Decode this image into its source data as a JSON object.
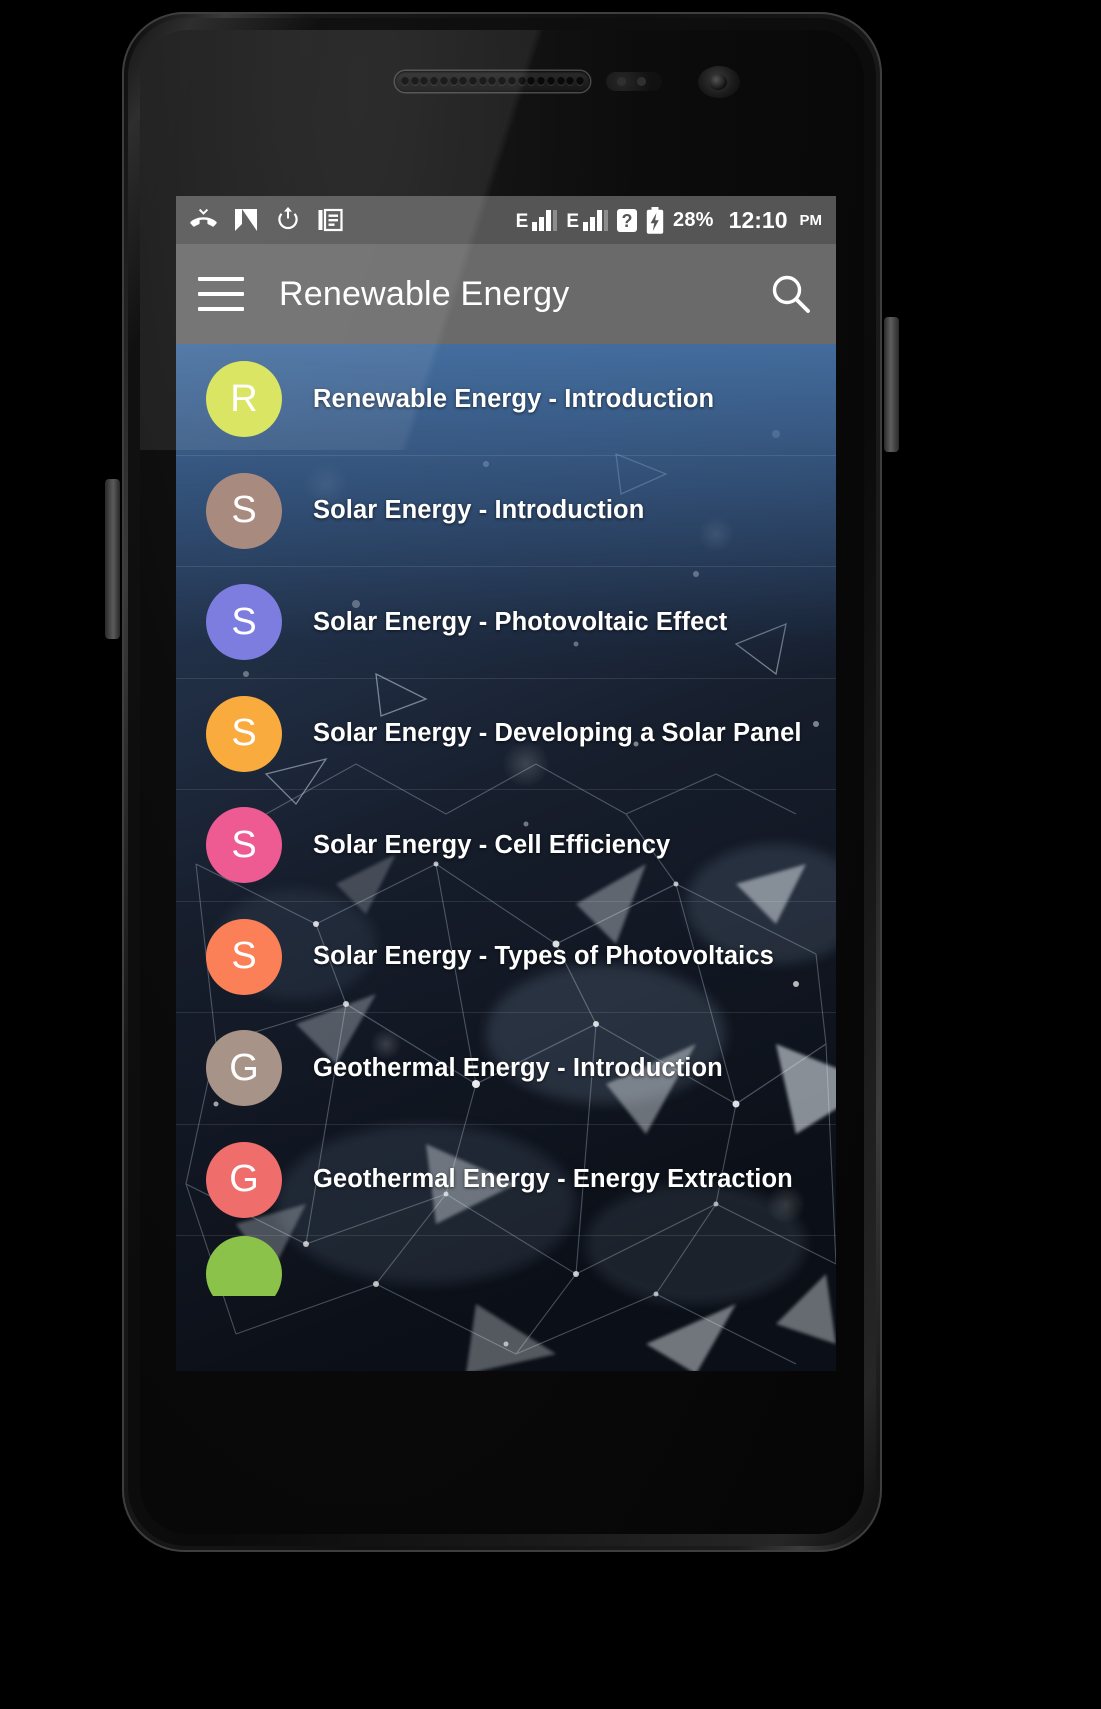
{
  "device": {
    "name": "android-phone"
  },
  "status_bar": {
    "left_icons": [
      "missed-call-icon",
      "nova-n-icon",
      "power-restart-icon",
      "document-list-icon"
    ],
    "sim1": {
      "network_label": "E",
      "signal_bars": 3
    },
    "sim2": {
      "network_label": "E",
      "signal_bars": 3
    },
    "question_icon": "question-mark-icon",
    "battery_icon": "battery-charging-icon",
    "battery_percent": "28%",
    "time": "12:10",
    "ampm": "PM"
  },
  "toolbar": {
    "menu_icon": "hamburger-menu-icon",
    "title": "Renewable Energy",
    "search_icon": "search-icon"
  },
  "colors": {
    "status_bar_bg": "#555555",
    "toolbar_bg": "#6a6a6a",
    "list_text": "#ffffff",
    "bg_dark": "#11161f",
    "bg_blue_tint": "#4976aa"
  },
  "list": {
    "items": [
      {
        "initial": "R",
        "color": "#d7e356",
        "title": "Renewable Energy - Introduction"
      },
      {
        "initial": "S",
        "color": "#a98a7e",
        "title": "Solar Energy - Introduction"
      },
      {
        "initial": "S",
        "color": "#7d7de0",
        "title": "Solar Energy - Photovoltaic Effect"
      },
      {
        "initial": "S",
        "color": "#f9ab3e",
        "title": "Solar Energy - Developing a Solar Panel"
      },
      {
        "initial": "S",
        "color": "#ee5b93",
        "title": "Solar Energy - Cell Efficiency"
      },
      {
        "initial": "S",
        "color": "#fb8057",
        "title": "Solar Energy - Types of Photovoltaics"
      },
      {
        "initial": "G",
        "color": "#a89389",
        "title": "Geothermal Energy - Introduction"
      },
      {
        "initial": "G",
        "color": "#ef6d6b",
        "title": "Geothermal Energy - Energy Extraction"
      },
      {
        "initial": "",
        "color": "#8bc34a",
        "title": ""
      }
    ]
  }
}
